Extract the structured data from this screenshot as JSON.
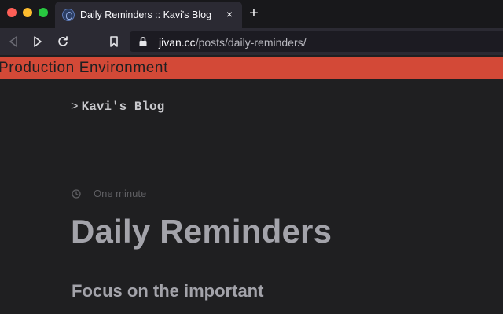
{
  "browser": {
    "tab": {
      "title": "Daily Reminders :: Kavi's Blog",
      "close_glyph": "×"
    },
    "new_tab_glyph": "+",
    "url": {
      "host": "jivan.cc",
      "path": "/posts/daily-reminders/"
    }
  },
  "environment": {
    "label": "Production Environment",
    "color": "#d34937"
  },
  "page": {
    "logo": {
      "mark": ">",
      "text": "Kavi's Blog"
    },
    "reading_time": "One minute",
    "title": "Daily Reminders",
    "heading": "Focus on the important"
  },
  "icons": {
    "traffic_lights": [
      "close-icon",
      "minimize-icon",
      "zoom-icon"
    ],
    "nav": [
      "back-icon",
      "forward-icon",
      "reload-icon",
      "bookmark-icon",
      "lock-icon"
    ],
    "meta": "clock-icon"
  }
}
